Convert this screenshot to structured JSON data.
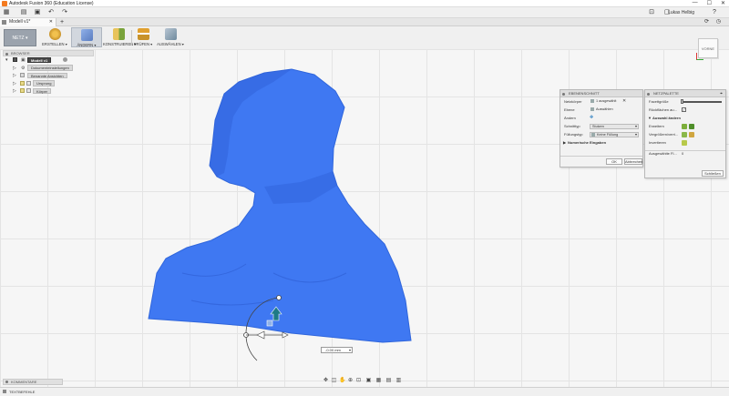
{
  "window": {
    "title": "Autodesk Fusion 360 (Education License)",
    "controls": [
      "—",
      "☐",
      "✕"
    ]
  },
  "quickbar": {
    "user": "Lukas Helbig"
  },
  "tabs": {
    "doc_tab": "Modell v1*"
  },
  "toolbar": {
    "workspace": "NETZ ▾",
    "tools": [
      {
        "label": "ERSTELLEN ▾",
        "color": "#c8922a"
      },
      {
        "label": "ÄNDERN ▾",
        "color": "#5a7cc0"
      },
      {
        "label": "KONSTRUIEREN ▾",
        "color": "#d19b2e"
      },
      {
        "label": "PRÜFEN ▾",
        "color": "#c8922a"
      },
      {
        "label": "AUSWÄHLEN ▾",
        "color": "#6f8a9e"
      }
    ]
  },
  "browser": {
    "title": "BROWSER",
    "root": "Modell v1",
    "items": [
      {
        "label": "Dokumenteinstellungen"
      },
      {
        "label": "Benannte Ansichten"
      },
      {
        "label": "Ursprung"
      },
      {
        "label": "Körper"
      }
    ]
  },
  "viewcube": {
    "label": "VORNE"
  },
  "ebenenschnitt": {
    "title": "EBENENSCHNITT",
    "rows": [
      {
        "key": "Netzkörper",
        "value": "1 ausgewählt"
      },
      {
        "key": "Ebene",
        "value": "Auswählen"
      },
      {
        "key": "Ändern",
        "value": ""
      },
      {
        "key": "Schnitttyp",
        "value": "Stutzen"
      },
      {
        "key": "Füllungstyp",
        "value": "Keine Füllung"
      }
    ],
    "section": "Numerische Eingaben",
    "ok": "OK",
    "cancel": "Abbrechen"
  },
  "netzpalette": {
    "title": "NETZPALETTE",
    "rows": [
      {
        "key": "Facettgröße"
      },
      {
        "key": "Rückflächen au..."
      }
    ],
    "section": "Auswahl ändern",
    "sel_rows": [
      {
        "key": "Erweitern"
      },
      {
        "key": "Vergrößern/verri..."
      },
      {
        "key": "Invertieren"
      }
    ],
    "count_label": "Ausgewählte Fl...",
    "count_value": "0",
    "close": "Schließen"
  },
  "dimension": {
    "value": "-0.00 mm"
  },
  "comments": {
    "label": "KOMMENTARE"
  },
  "status": {
    "text": "TEXTBEFEHLE"
  },
  "colors": {
    "mesh": "#3f78f2",
    "mesh_shadow": "#2f5fd8",
    "manipulator": "#1e7a86"
  }
}
